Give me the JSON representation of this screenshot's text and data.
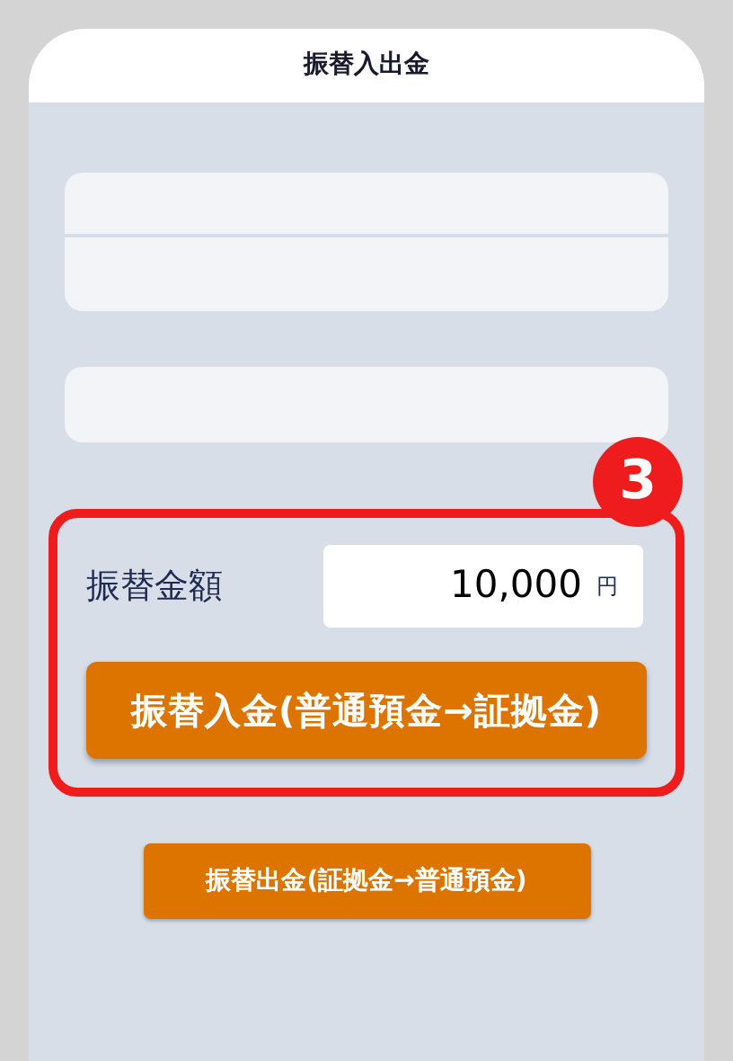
{
  "header": {
    "title": "振替入出金"
  },
  "step_badge": "3",
  "amount": {
    "label": "振替金額",
    "value": "10,000",
    "unit": "円"
  },
  "buttons": [
    {
      "label": "振替入金(普通預金→証拠金)",
      "kind": "primary"
    },
    {
      "label": "振替出金(証拠金→普通預金)",
      "kind": "secondary"
    }
  ]
}
